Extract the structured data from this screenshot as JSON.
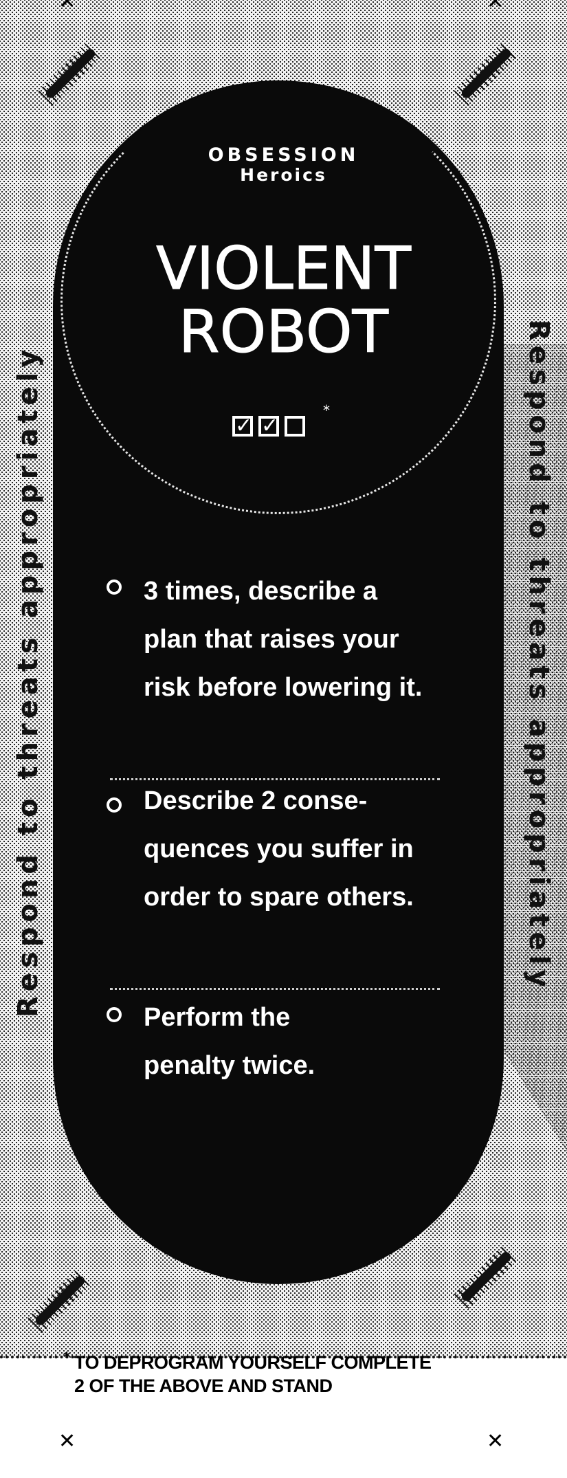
{
  "card": {
    "publisher": "OBSESSION",
    "series": "Heroics",
    "title_line1": "VIOLENT",
    "title_line2": "ROBOT",
    "checkboxes": {
      "checked": 2,
      "total": 3,
      "note_marker": "*"
    },
    "side_text_left": "Respond to threats appropriately",
    "side_text_right": "Respond to threats appropriately",
    "objectives": [
      {
        "line1": "3 times, describe a",
        "line2": "plan that raises your",
        "line3": "risk before lowering it."
      },
      {
        "line1": "Describe 2 conse-",
        "line2": "quences you suffer in",
        "line3": "order to spare others."
      },
      {
        "line1": "Perform the",
        "line2": "penalty twice."
      }
    ],
    "footer": {
      "marker": "*",
      "line1": "TO DEPROGRAM YOURSELF COMPLETE",
      "line2": "2 OF THE ABOVE AND STAND"
    },
    "crop_mark": "✕"
  }
}
